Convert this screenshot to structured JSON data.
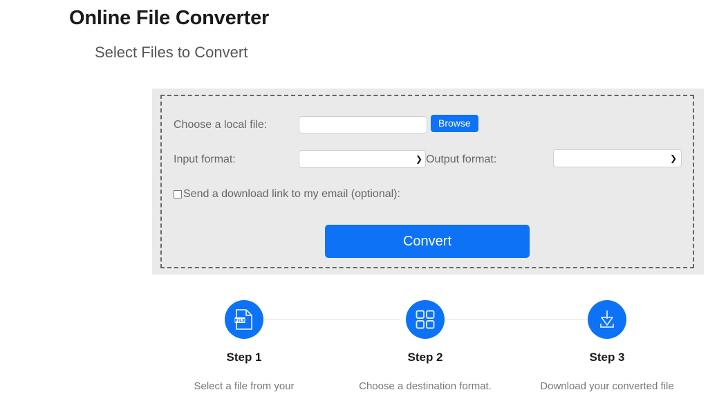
{
  "header": {
    "title": "Online File Converter",
    "subtitle": "Select Files to Convert"
  },
  "form": {
    "file_label": "Choose a local file:",
    "file_value": "",
    "file_placeholder": "",
    "browse_label": "Browse",
    "input_format_label": "Input format:",
    "input_format_value": "",
    "output_format_label": "Output format:",
    "output_format_value": "",
    "dropdown_icon": "chevron-down-icon",
    "email_checkbox_checked": false,
    "email_label": "Send a download link to my email (optional):",
    "convert_label": "Convert"
  },
  "steps": [
    {
      "icon": "file-document-icon",
      "title": "Step 1",
      "description": "Select a file from your"
    },
    {
      "icon": "grid-squares-icon",
      "title": "Step 2",
      "description": "Choose a destination format."
    },
    {
      "icon": "download-icon",
      "title": "Step 3",
      "description": "Download your converted file"
    }
  ],
  "colors": {
    "accent": "#0d72f5",
    "panel_background": "#eaeaea",
    "dashed_border": "#666666",
    "text_muted": "#666666",
    "text_dark": "#1a1a1a"
  }
}
